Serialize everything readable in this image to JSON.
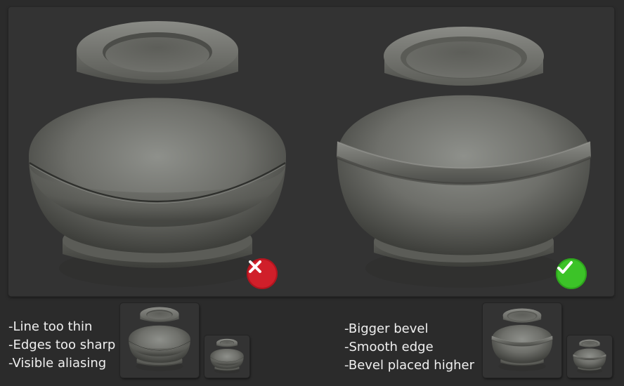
{
  "comparison": {
    "bad": {
      "badge_icon": "cross-icon",
      "badge_color": "#d01f2a",
      "notes": [
        "-Line too thin",
        "-Edges too sharp",
        "-Visible aliasing"
      ]
    },
    "good": {
      "badge_icon": "check-icon",
      "badge_color": "#3cc328",
      "notes": [
        "-Bigger bevel",
        "-Smooth edge",
        "-Bevel placed higher"
      ]
    }
  },
  "colors": {
    "background": "#2b2b2b",
    "panel": "#333333",
    "clay": "#7a7a74"
  }
}
